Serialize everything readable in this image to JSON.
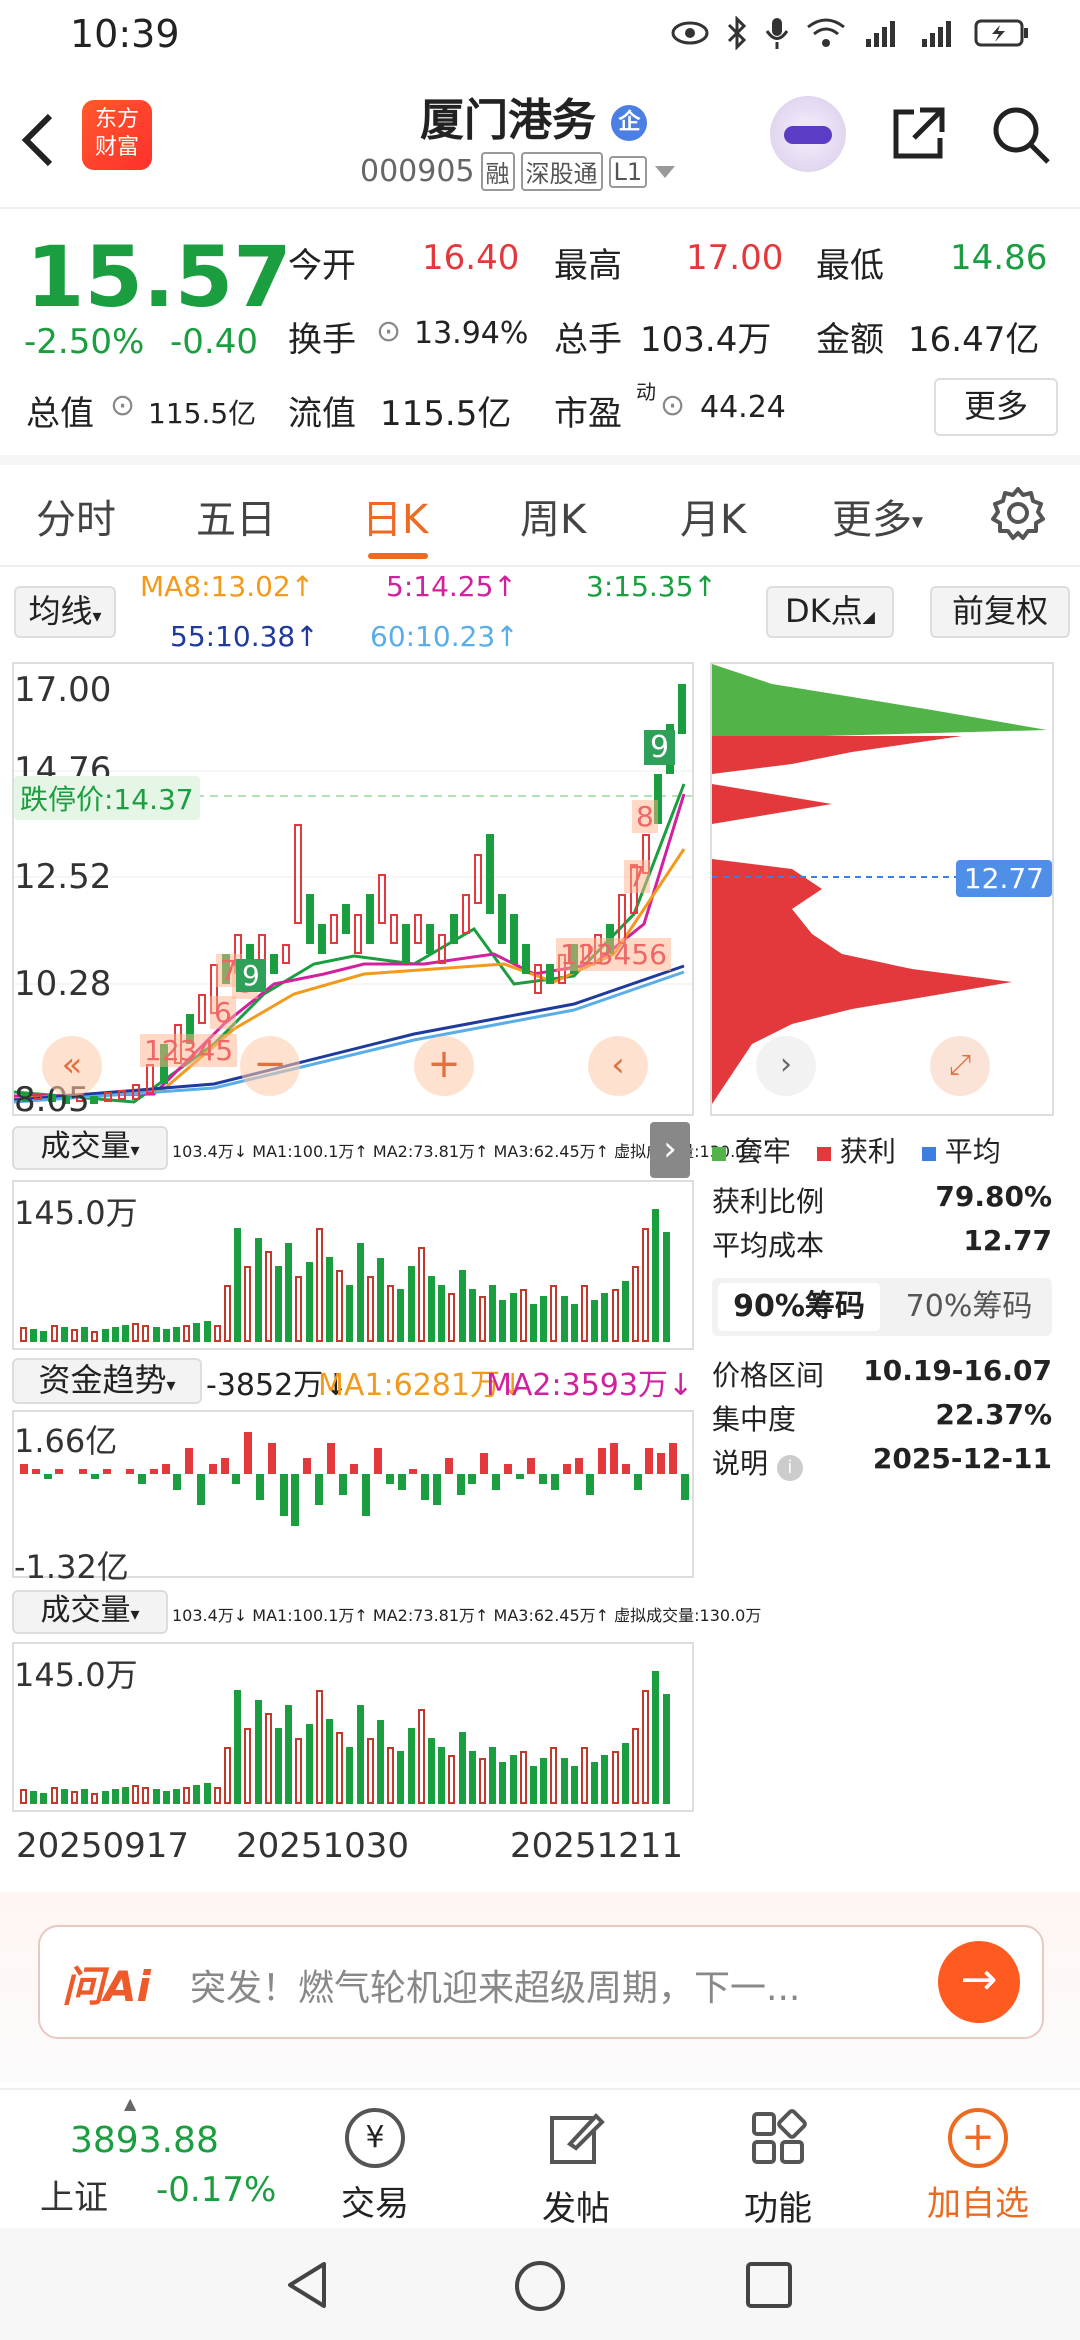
{
  "status_bar": {
    "time": "10:39"
  },
  "header": {
    "logo_line1": "东方",
    "logo_line2": "财富",
    "stock_name": "厦门港务",
    "badge": "企",
    "code": "000905",
    "tags": [
      "融",
      "深股通",
      "L1"
    ]
  },
  "quote": {
    "price": "15.57",
    "change_pct": "-2.50%",
    "change_abs": "-0.40",
    "open_label": "今开",
    "open": "16.40",
    "high_label": "最高",
    "high": "17.00",
    "low_label": "最低",
    "low": "14.86",
    "turnover_label": "换手",
    "turnover": "13.94%",
    "volume_label": "总手",
    "volume": "103.4万",
    "amount_label": "金额",
    "amount": "16.47亿",
    "mktcap_label": "总值",
    "mktcap": "115.5亿",
    "float_label": "流值",
    "float": "115.5亿",
    "pe_label": "市盈",
    "pe_sup": "动",
    "pe": "44.24",
    "more_label": "更多"
  },
  "tabs": [
    "分时",
    "五日",
    "日K",
    "周K",
    "月K",
    "更多"
  ],
  "chart_header": {
    "ma_button": "均线",
    "ma8": "MA8:13.02↑",
    "ma5": "5:14.25↑",
    "ma3": "3:15.35↑",
    "ma55": "55:10.38↑",
    "ma60": "60:10.23↑",
    "dk_button": "DK点",
    "adjust_button": "前复权"
  },
  "kline": {
    "y_labels": [
      "17.00",
      "14.76",
      "12.52",
      "10.28",
      "8.05"
    ],
    "limit_down": "跌停价:14.37",
    "markers": [
      "1",
      "2",
      "3",
      "4",
      "5",
      "7",
      "8",
      "9",
      "6",
      "1",
      "2",
      "3",
      "4",
      "5",
      "6",
      "7",
      "8",
      "9"
    ]
  },
  "volume_panel": {
    "title": "成交量",
    "info": "103.4万↓ MA1:100.1万↑ MA2:73.81万↑ MA3:62.45万↑ 虚拟成交量:130.0万",
    "y_max": "145.0万"
  },
  "fund_panel": {
    "title": "资金趋势",
    "value": "-3852万↓",
    "ma1": "MA1:6281万↓",
    "ma2": "MA2:3593万↓",
    "y_max": "1.66亿",
    "y_min": "-1.32亿"
  },
  "volume_panel2": {
    "title": "成交量",
    "info": "103.4万↓ MA1:100.1万↑ MA2:73.81万↑ MA3:62.45万↑ 虚拟成交量:130.0万",
    "y_max": "145.0万"
  },
  "x_axis": [
    "20250917",
    "20251030",
    "20251211"
  ],
  "chip": {
    "price_tag": "12.77",
    "legend": [
      "套牢",
      "获利",
      "平均"
    ],
    "profit_ratio_label": "获利比例",
    "profit_ratio": "79.80%",
    "avg_cost_label": "平均成本",
    "avg_cost": "12.77",
    "tab90": "90%筹码",
    "tab70": "70%筹码",
    "range_label": "价格区间",
    "range": "10.19-16.07",
    "concentration_label": "集中度",
    "concentration": "22.37%",
    "note_label": "说明",
    "note_date": "2025-12-11"
  },
  "ai": {
    "brand": "问Ai",
    "text": "突发！燃气轮机迎来超级周期，下一..."
  },
  "bottom_nav": {
    "index_value": "3893.88",
    "index_name": "上证",
    "index_change": "-0.17%",
    "items": [
      "交易",
      "发帖",
      "功能",
      "加自选"
    ]
  },
  "colors": {
    "up": "#e4393c",
    "down": "#1a9e3f",
    "accent": "#ee6a21",
    "chip_avg": "#3d7fe0"
  }
}
